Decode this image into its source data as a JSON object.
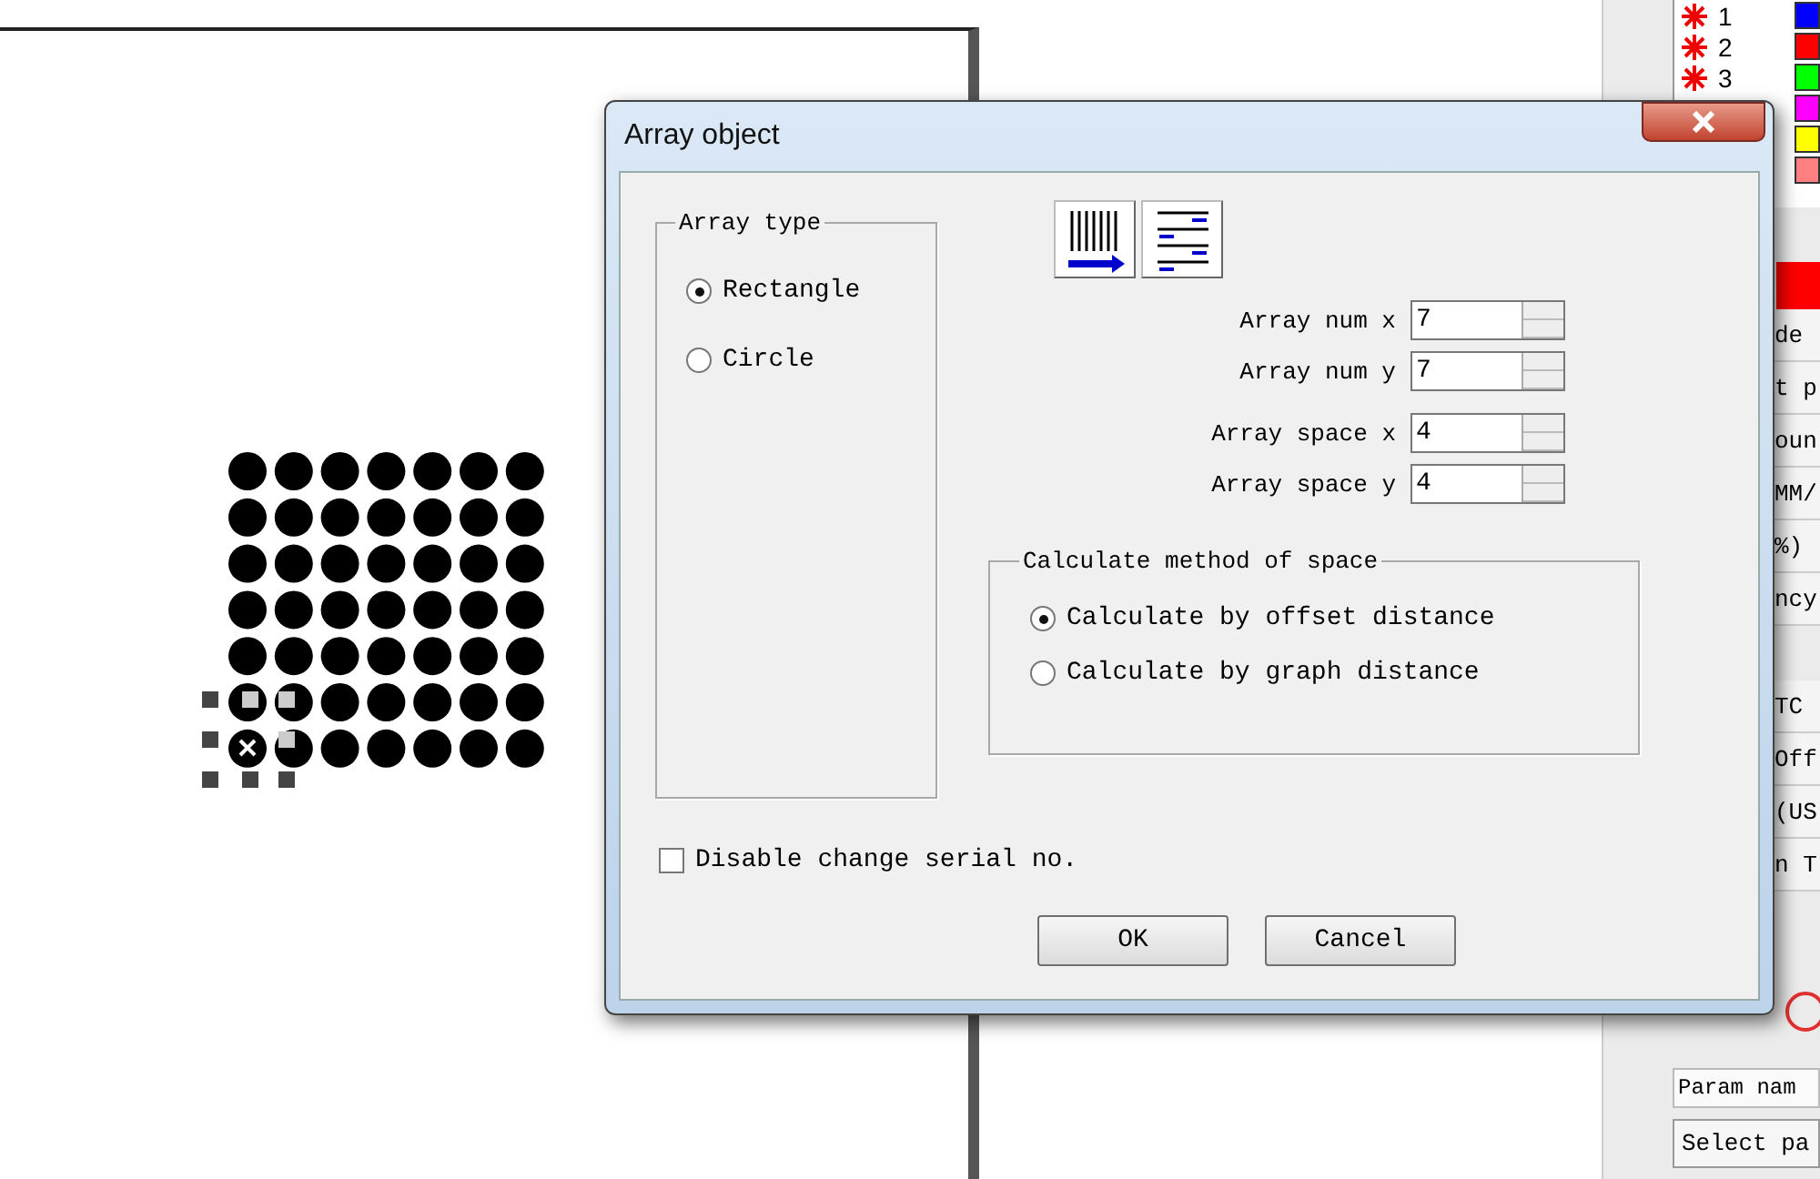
{
  "layers": [
    {
      "label": "1",
      "color": "#0000ff"
    },
    {
      "label": "2",
      "color": "#ff0000"
    },
    {
      "label": "3",
      "color": "#00ff00"
    },
    {
      "color": "#ff00ff"
    },
    {
      "color": "#ffff00"
    },
    {
      "color": "#ff8080"
    }
  ],
  "property_rows": [
    {
      "kind": "swatch",
      "color": "#ff0000"
    },
    {
      "kind": "text",
      "text": "de"
    },
    {
      "kind": "text",
      "text": "t p"
    },
    {
      "kind": "text",
      "text": "oun"
    },
    {
      "kind": "text",
      "text": "MM/"
    },
    {
      "kind": "text",
      "text": "%)"
    },
    {
      "kind": "text",
      "text": "ncy"
    },
    {
      "kind": "gap"
    },
    {
      "kind": "text",
      "text": "TC"
    },
    {
      "kind": "text",
      "text": "Off"
    },
    {
      "kind": "text",
      "text": "(US"
    },
    {
      "kind": "text",
      "text": "n T"
    }
  ],
  "param_label": "Param nam",
  "param_select": "Select pa",
  "dialog": {
    "title": "Array object",
    "array_type": {
      "legend": "Array type",
      "options": [
        {
          "label": "Rectangle",
          "selected": true
        },
        {
          "label": "Circle",
          "selected": false
        }
      ]
    },
    "fields": [
      {
        "label": "Array num x",
        "value": "7"
      },
      {
        "label": "Array num y",
        "value": "7"
      },
      {
        "label": "Array space x",
        "value": "4"
      },
      {
        "label": "Array space y",
        "value": "4"
      }
    ],
    "method": {
      "legend": "Calculate method of space",
      "options": [
        {
          "label": "Calculate by offset distance",
          "selected": true
        },
        {
          "label": "Calculate by graph distance",
          "selected": false
        }
      ]
    },
    "disable_serial": {
      "label": "Disable change serial no.",
      "checked": false
    },
    "buttons": [
      "OK",
      "Cancel"
    ]
  }
}
